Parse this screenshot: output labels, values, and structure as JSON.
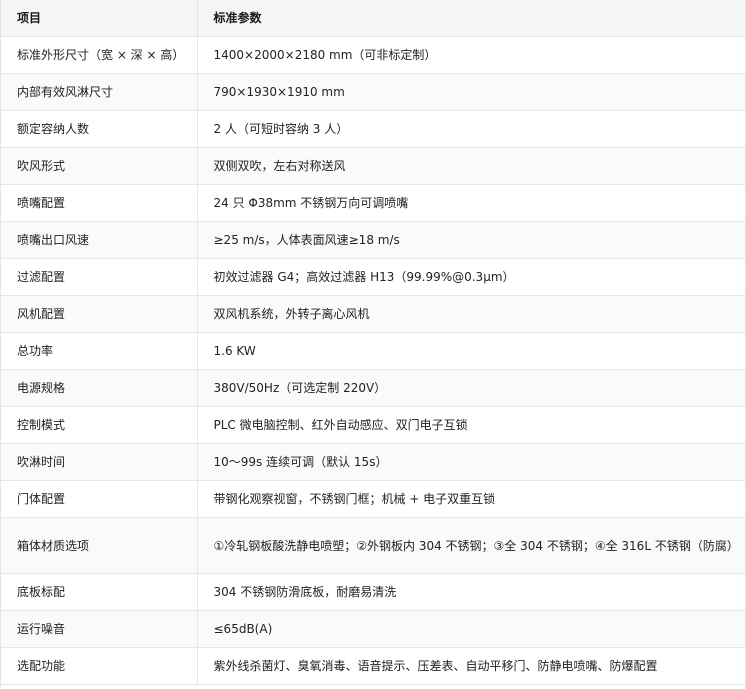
{
  "table": {
    "headers": [
      "项目",
      "标准参数"
    ],
    "rows": [
      [
        "标准外形尺寸（宽 × 深 × 高）",
        "1400×2000×2180 mm（可非标定制）"
      ],
      [
        "内部有效风淋尺寸",
        "790×1930×1910 mm"
      ],
      [
        "额定容纳人数",
        "2 人（可短时容纳 3 人）"
      ],
      [
        "吹风形式",
        "双侧双吹，左右对称送风"
      ],
      [
        "喷嘴配置",
        "24 只 Φ38mm 不锈钢万向可调喷嘴"
      ],
      [
        "喷嘴出口风速",
        "≥25 m/s，人体表面风速≥18 m/s"
      ],
      [
        "过滤配置",
        "初效过滤器 G4；高效过滤器 H13（99.99%@0.3μm）"
      ],
      [
        "风机配置",
        "双风机系统，外转子离心风机"
      ],
      [
        "总功率",
        "1.6 KW"
      ],
      [
        "电源规格",
        "380V/50Hz（可选定制 220V）"
      ],
      [
        "控制模式",
        "PLC 微电脑控制、红外自动感应、双门电子互锁"
      ],
      [
        "吹淋时间",
        "10～99s 连续可调（默认 15s）"
      ],
      [
        "门体配置",
        "带钢化观察视窗，不锈钢门框；机械 + 电子双重互锁"
      ],
      [
        "箱体材质选项",
        "①冷轧钢板酸洗静电喷塑；②外钢板内 304 不锈钢；③全 304 不锈钢；④全 316L 不锈钢（防腐）"
      ],
      [
        "底板标配",
        "304 不锈钢防滑底板，耐磨易清洗"
      ],
      [
        "运行噪音",
        "≤65dB(A)"
      ],
      [
        "选配功能",
        "紫外线杀菌灯、臭氧消毒、语音提示、压差表、自动平移门、防静电喷嘴、防爆配置"
      ]
    ]
  }
}
